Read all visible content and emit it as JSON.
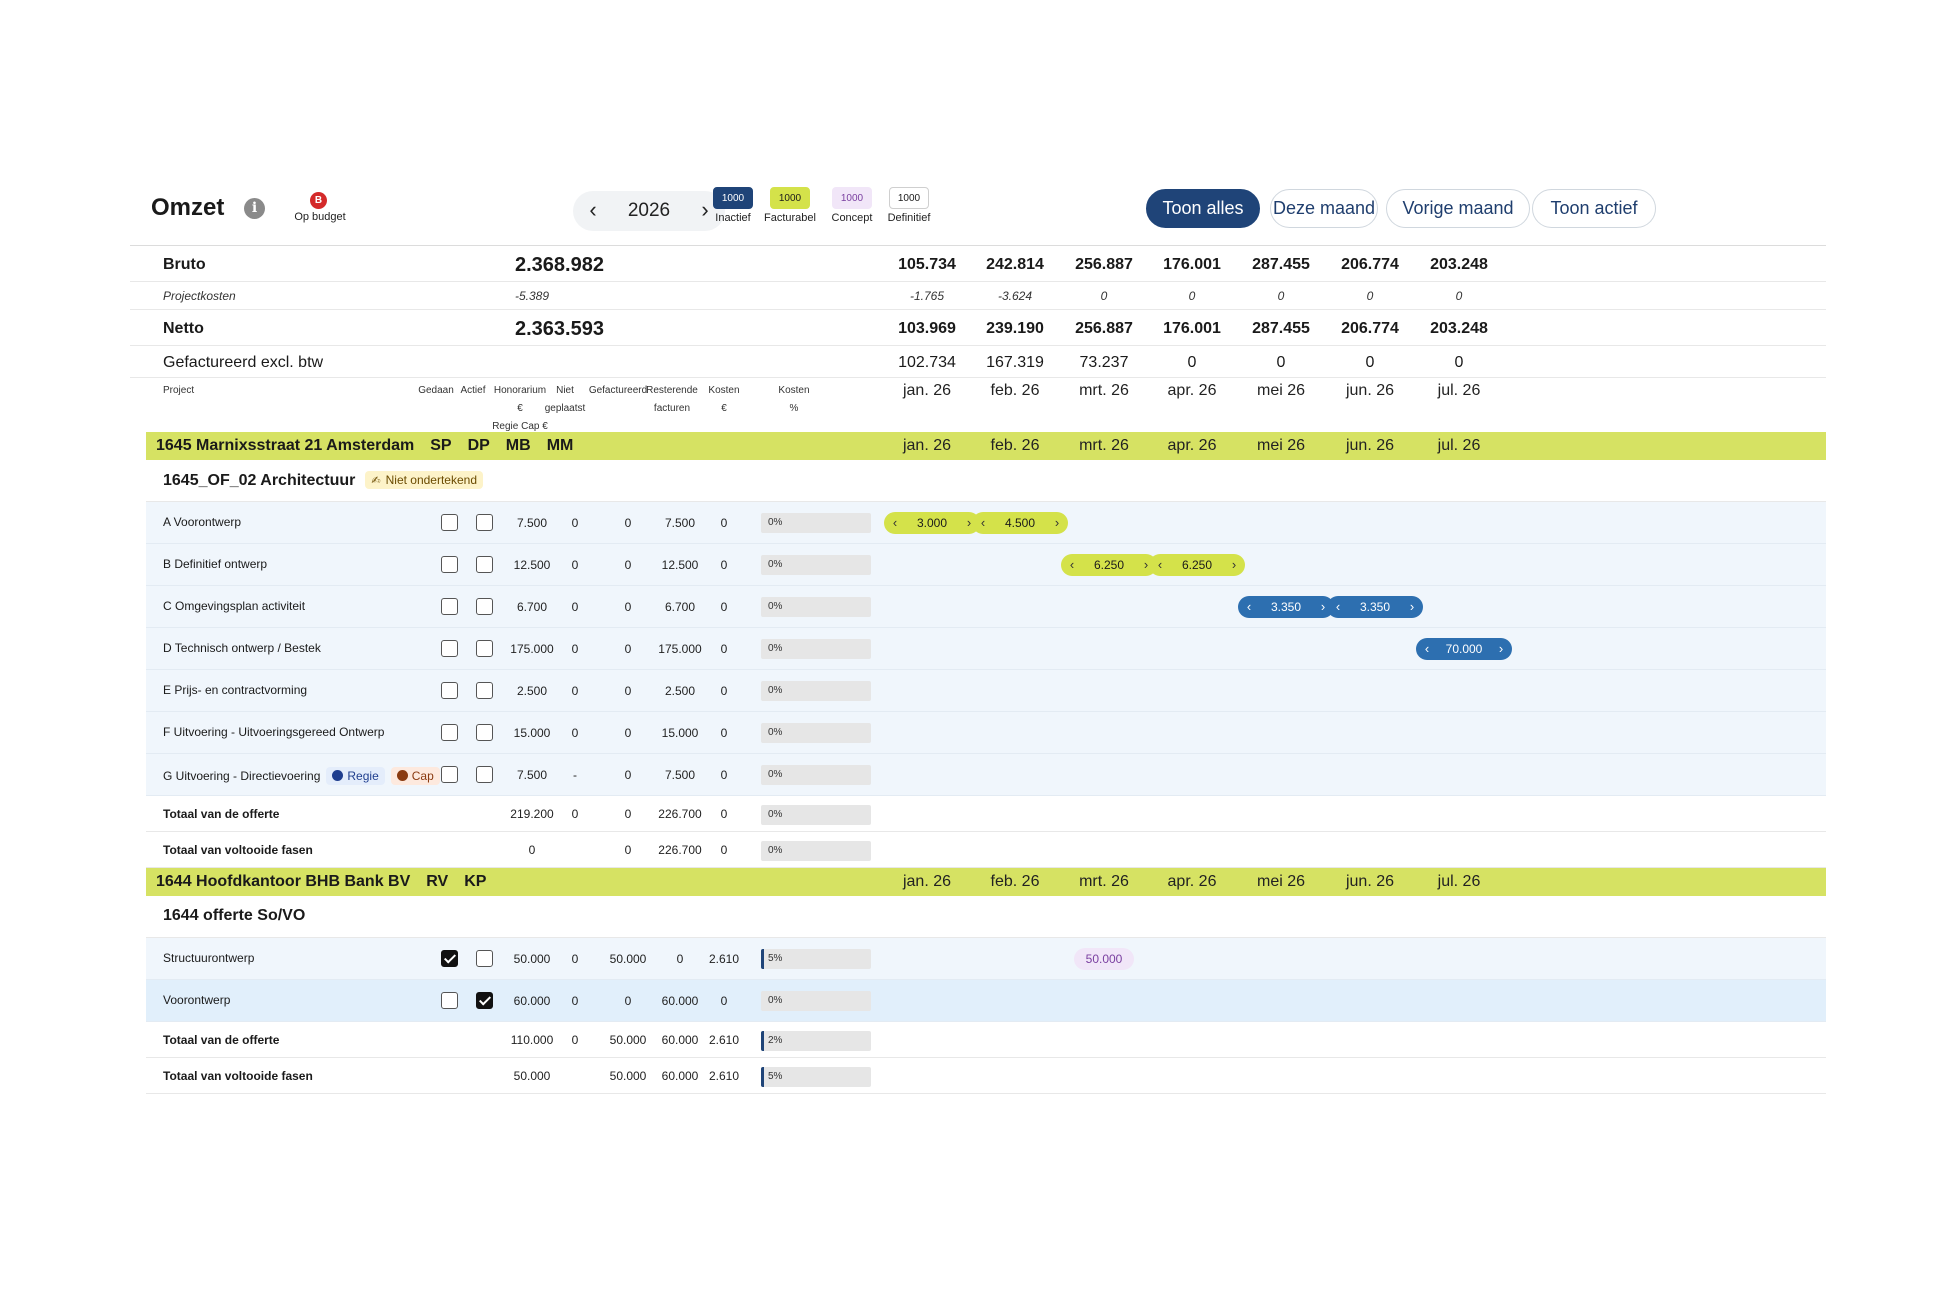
{
  "header": {
    "title": "Omzet",
    "info_icon": "info-icon",
    "budget_badge": "B",
    "budget_label": "Op budget",
    "year": "2026",
    "prev_icon": "‹",
    "next_icon": "›",
    "legend": [
      {
        "value": "1000",
        "label": "Inactief",
        "bg": "#1f4478",
        "fg": "#ffffff",
        "border": "#1f4478"
      },
      {
        "value": "1000",
        "label": "Facturabel",
        "bg": "#d4e24a",
        "fg": "#1a1a1a",
        "border": "#d4e24a"
      },
      {
        "value": "1000",
        "label": "Concept",
        "bg": "#f1e6f8",
        "fg": "#7a3fa0",
        "border": "#f1e6f8"
      },
      {
        "value": "1000",
        "label": "Definitief",
        "bg": "#ffffff",
        "fg": "#1a1a1a",
        "border": "#cfcfcf"
      }
    ],
    "buttons": [
      {
        "label": "Toon alles",
        "active": true
      },
      {
        "label": "Deze maand",
        "active": false
      },
      {
        "label": "Vorige maand",
        "active": false
      },
      {
        "label": "Toon actief",
        "active": false
      }
    ]
  },
  "summary": {
    "bruto": {
      "label": "Bruto",
      "total": "2.368.982",
      "months": [
        "105.734",
        "242.814",
        "256.887",
        "176.001",
        "287.455",
        "206.774",
        "203.248"
      ]
    },
    "projectkosten": {
      "label": "Projectkosten",
      "total": "-5.389",
      "months": [
        "-1.765",
        "-3.624",
        "0",
        "0",
        "0",
        "0",
        "0"
      ]
    },
    "netto": {
      "label": "Netto",
      "total": "2.363.593",
      "months": [
        "103.969",
        "239.190",
        "256.887",
        "176.001",
        "287.455",
        "206.774",
        "203.248"
      ]
    },
    "gefactureerd": {
      "label": "Gefactureerd excl. btw",
      "months": [
        "102.734",
        "167.319",
        "73.237",
        "0",
        "0",
        "0",
        "0"
      ]
    }
  },
  "columns": {
    "project": "Project",
    "gedaan": "Gedaan",
    "actief": "Actief",
    "honorarium": [
      "Honorarium",
      "€",
      "Regie Cap €"
    ],
    "niet_geplaatst": [
      "Niet",
      "geplaatst"
    ],
    "gefactureerd": "Gefactureerd",
    "resterende": [
      "Resterende",
      "facturen"
    ],
    "kosten_eur": [
      "Kosten",
      "€"
    ],
    "kosten_pct": [
      "Kosten",
      "%"
    ],
    "months": [
      "jan. 26",
      "feb. 26",
      "mrt. 26",
      "apr. 26",
      "mei 26",
      "jun. 26",
      "jul. 26"
    ]
  },
  "projects": [
    {
      "name": "1645 Marnixsstraat 21 Amsterdam",
      "tags": [
        "SP",
        "DP",
        "MB",
        "MM"
      ],
      "months": [
        "jan. 26",
        "feb. 26",
        "mrt. 26",
        "apr. 26",
        "mei 26",
        "jun. 26",
        "jul. 26"
      ],
      "offer": {
        "name": "1645_OF_02 Architectuur",
        "badge": "Niet ondertekend",
        "badge_icon": "signature-icon"
      },
      "phases": [
        {
          "name": "A Voorontwerp",
          "gedaan": false,
          "actief": false,
          "honorarium": "7.500",
          "niet": "0",
          "gef": "0",
          "rest": "7.500",
          "kosten": "0",
          "pct": "0%",
          "pct_val": 0,
          "pills": [
            {
              "m": 0,
              "v": "3.000",
              "type": "yellow"
            },
            {
              "m": 1,
              "v": "4.500",
              "type": "yellow"
            }
          ]
        },
        {
          "name": "B Definitief ontwerp",
          "gedaan": false,
          "actief": false,
          "honorarium": "12.500",
          "niet": "0",
          "gef": "0",
          "rest": "12.500",
          "kosten": "0",
          "pct": "0%",
          "pct_val": 0,
          "pills": [
            {
              "m": 2,
              "v": "6.250",
              "type": "yellow"
            },
            {
              "m": 3,
              "v": "6.250",
              "type": "yellow"
            }
          ]
        },
        {
          "name": "C Omgevingsplan activiteit",
          "gedaan": false,
          "actief": false,
          "honorarium": "6.700",
          "niet": "0",
          "gef": "0",
          "rest": "6.700",
          "kosten": "0",
          "pct": "0%",
          "pct_val": 0,
          "pills": [
            {
              "m": 4,
              "v": "3.350",
              "type": "blue"
            },
            {
              "m": 5,
              "v": "3.350",
              "type": "blue"
            }
          ]
        },
        {
          "name": "D Technisch ontwerp / Bestek",
          "gedaan": false,
          "actief": false,
          "honorarium": "175.000",
          "niet": "0",
          "gef": "0",
          "rest": "175.000",
          "kosten": "0",
          "pct": "0%",
          "pct_val": 0,
          "pills": [
            {
              "m": 6,
              "v": "70.000",
              "type": "blue"
            }
          ]
        },
        {
          "name": "E Prijs- en contractvorming",
          "gedaan": false,
          "actief": false,
          "honorarium": "2.500",
          "niet": "0",
          "gef": "0",
          "rest": "2.500",
          "kosten": "0",
          "pct": "0%",
          "pct_val": 0,
          "pills": []
        },
        {
          "name": "F Uitvoering - Uitvoeringsgereed Ontwerp",
          "gedaan": false,
          "actief": false,
          "honorarium": "15.000",
          "niet": "0",
          "gef": "0",
          "rest": "15.000",
          "kosten": "0",
          "pct": "0%",
          "pct_val": 0,
          "pills": []
        },
        {
          "name": "G Uitvoering - Directievoering",
          "gedaan": false,
          "actief": false,
          "honorarium": "7.500",
          "niet": "-",
          "gef": "0",
          "rest": "7.500",
          "kosten": "0",
          "pct": "0%",
          "pct_val": 0,
          "pills": [],
          "badges": [
            {
              "label": "Regie",
              "type": "regie"
            },
            {
              "label": "Cap",
              "type": "cap"
            }
          ]
        }
      ],
      "totals": [
        {
          "label": "Totaal van de offerte",
          "honorarium": "219.200",
          "niet": "0",
          "gef": "0",
          "rest": "226.700",
          "kosten": "0",
          "pct": "0%",
          "pct_val": 0
        },
        {
          "label": "Totaal van voltooide fasen",
          "honorarium": "0",
          "niet": "",
          "gef": "0",
          "rest": "226.700",
          "kosten": "0",
          "pct": "0%",
          "pct_val": 0
        }
      ]
    },
    {
      "name": "1644 Hoofdkantoor BHB Bank BV",
      "tags": [
        "RV",
        "KP"
      ],
      "months": [
        "jan. 26",
        "feb. 26",
        "mrt. 26",
        "apr. 26",
        "mei 26",
        "jun. 26",
        "jul. 26"
      ],
      "offer": {
        "name": "1644 offerte So/VO"
      },
      "phases": [
        {
          "name": "Structuurontwerp",
          "gedaan": true,
          "actief": false,
          "honorarium": "50.000",
          "niet": "0",
          "gef": "50.000",
          "rest": "0",
          "kosten": "2.610",
          "pct": "5%",
          "pct_val": 5,
          "pills": [
            {
              "m": 2,
              "v": "50.000",
              "type": "concept"
            }
          ]
        },
        {
          "name": "Voorontwerp",
          "gedaan": false,
          "actief": true,
          "honorarium": "60.000",
          "niet": "0",
          "gef": "0",
          "rest": "60.000",
          "kosten": "0",
          "pct": "0%",
          "pct_val": 0,
          "pills": [],
          "highlight": true
        }
      ],
      "totals": [
        {
          "label": "Totaal van de offerte",
          "honorarium": "110.000",
          "niet": "0",
          "gef": "50.000",
          "rest": "60.000",
          "kosten": "2.610",
          "pct": "2%",
          "pct_val": 2
        },
        {
          "label": "Totaal van voltooide fasen",
          "honorarium": "50.000",
          "niet": "",
          "gef": "50.000",
          "rest": "60.000",
          "kosten": "2.610",
          "pct": "5%",
          "pct_val": 5
        }
      ]
    }
  ]
}
